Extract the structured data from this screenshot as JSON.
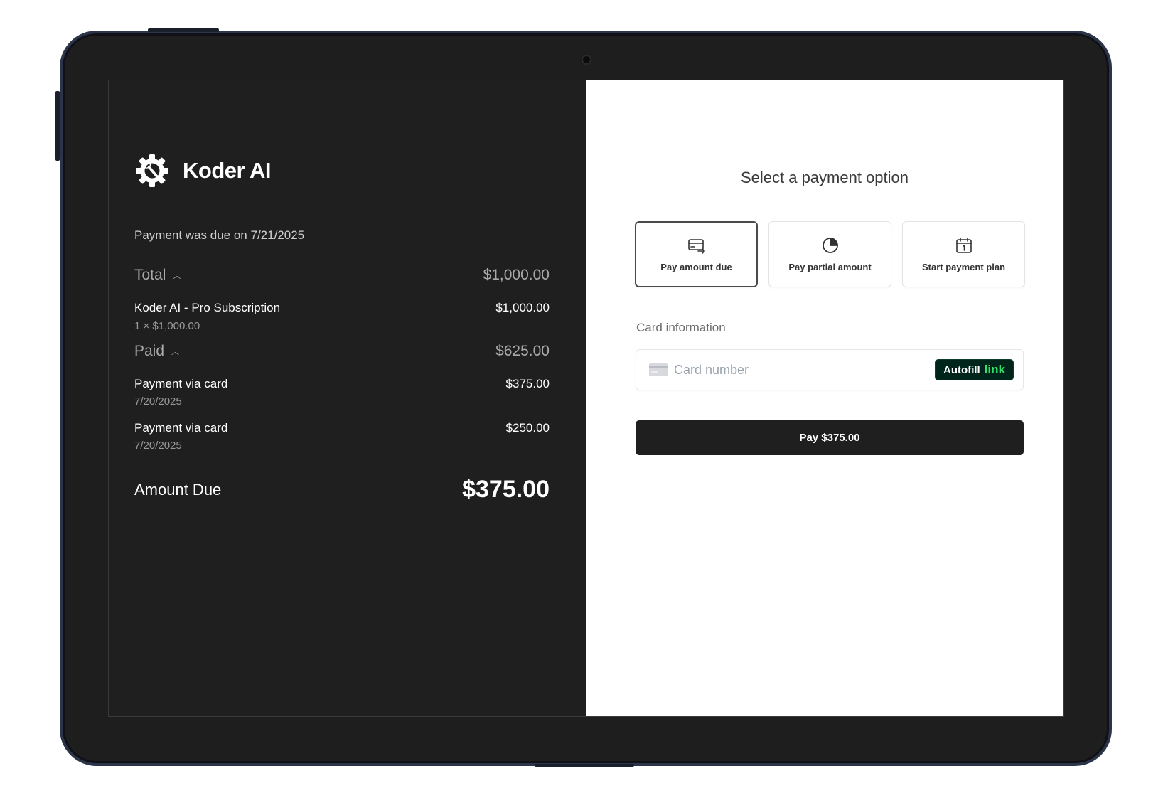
{
  "merchant": {
    "name": "Koder AI",
    "logo_icon": "gear-wrench-logo"
  },
  "summary": {
    "due_note": "Payment was due on 7/21/2025",
    "total": {
      "label": "Total",
      "amount": "$1,000.00",
      "items": [
        {
          "title": "Koder AI - Pro Subscription",
          "subtitle": "1 × $1,000.00",
          "amount": "$1,000.00"
        }
      ]
    },
    "paid": {
      "label": "Paid",
      "amount": "$625.00",
      "items": [
        {
          "title": "Payment via card",
          "subtitle": "7/20/2025",
          "amount": "$375.00"
        },
        {
          "title": "Payment via card",
          "subtitle": "7/20/2025",
          "amount": "$250.00"
        }
      ]
    },
    "amount_due": {
      "label": "Amount Due",
      "amount": "$375.00"
    }
  },
  "payment": {
    "heading": "Select a payment option",
    "options": [
      {
        "label": "Pay amount due",
        "icon": "card-transfer-icon",
        "selected": true
      },
      {
        "label": "Pay partial amount",
        "icon": "pie-chart-icon",
        "selected": false
      },
      {
        "label": "Start payment plan",
        "icon": "calendar-icon",
        "selected": false
      }
    ],
    "card_label": "Card information",
    "card_placeholder": "Card number",
    "card_value": "",
    "autofill_text": "Autofill",
    "autofill_link": "link",
    "pay_button": "Pay $375.00"
  },
  "colors": {
    "left_bg": "#1f1f20",
    "right_bg": "#ffffff",
    "link_green": "#31e36b",
    "autofill_bg": "#01251a",
    "device_frame": "#1e1e1f"
  }
}
